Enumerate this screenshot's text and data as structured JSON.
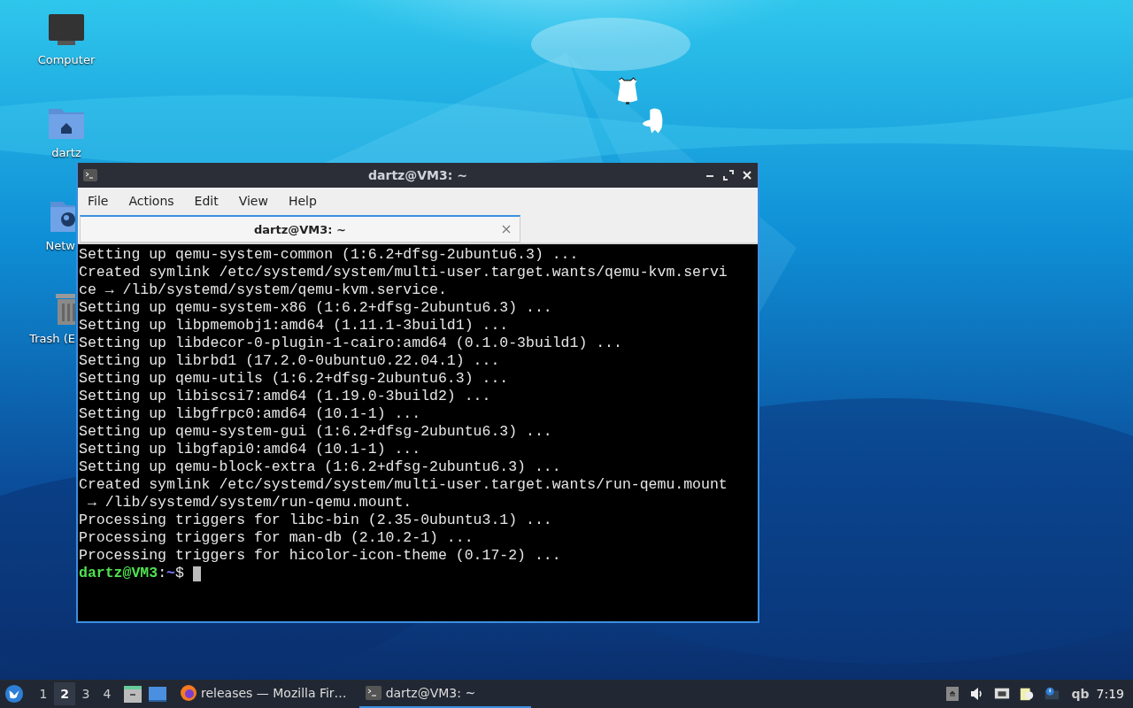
{
  "desktop_icons": [
    {
      "kind": "computer",
      "label": "Computer"
    },
    {
      "kind": "home",
      "label": "dartz"
    },
    {
      "kind": "network",
      "label": "Netw"
    },
    {
      "kind": "trash",
      "label": "Trash (E"
    }
  ],
  "terminal_window": {
    "title": "dartz@VM3: ~",
    "menu": [
      "File",
      "Actions",
      "Edit",
      "View",
      "Help"
    ],
    "tabs": [
      {
        "label": "dartz@VM3: ~",
        "selected": true
      }
    ],
    "lines": [
      "Setting up qemu-system-common (1:6.2+dfsg-2ubuntu6.3) ...",
      "Created symlink /etc/systemd/system/multi-user.target.wants/qemu-kvm.servi",
      "ce → /lib/systemd/system/qemu-kvm.service.",
      "Setting up qemu-system-x86 (1:6.2+dfsg-2ubuntu6.3) ...",
      "Setting up libpmemobj1:amd64 (1.11.1-3build1) ...",
      "Setting up libdecor-0-plugin-1-cairo:amd64 (0.1.0-3build1) ...",
      "Setting up librbd1 (17.2.0-0ubuntu0.22.04.1) ...",
      "Setting up qemu-utils (1:6.2+dfsg-2ubuntu6.3) ...",
      "Setting up libiscsi7:amd64 (1.19.0-3build2) ...",
      "Setting up libgfrpc0:amd64 (10.1-1) ...",
      "Setting up qemu-system-gui (1:6.2+dfsg-2ubuntu6.3) ...",
      "Setting up libgfapi0:amd64 (10.1-1) ...",
      "Setting up qemu-block-extra (1:6.2+dfsg-2ubuntu6.3) ...",
      "Created symlink /etc/systemd/system/multi-user.target.wants/run-qemu.mount",
      " → /lib/systemd/system/run-qemu.mount.",
      "Processing triggers for libc-bin (2.35-0ubuntu3.1) ...",
      "Processing triggers for man-db (2.10.2-1) ...",
      "Processing triggers for hicolor-icon-theme (0.17-2) ..."
    ],
    "prompt": {
      "user_host": "dartz@VM3",
      "separator": ":",
      "path": "~",
      "symbol": "$"
    }
  },
  "taskbar": {
    "workspaces": [
      {
        "label": "1",
        "selected": false
      },
      {
        "label": "2",
        "selected": true
      },
      {
        "label": "3",
        "selected": false
      },
      {
        "label": "4",
        "selected": false
      }
    ],
    "tasks": [
      {
        "kind": "browser",
        "label": "releases — Mozilla Fir…",
        "selected": false
      },
      {
        "kind": "terminal",
        "label": "dartz@VM3: ~",
        "selected": true
      }
    ],
    "tray_text": "qb",
    "clock": "7:19"
  }
}
